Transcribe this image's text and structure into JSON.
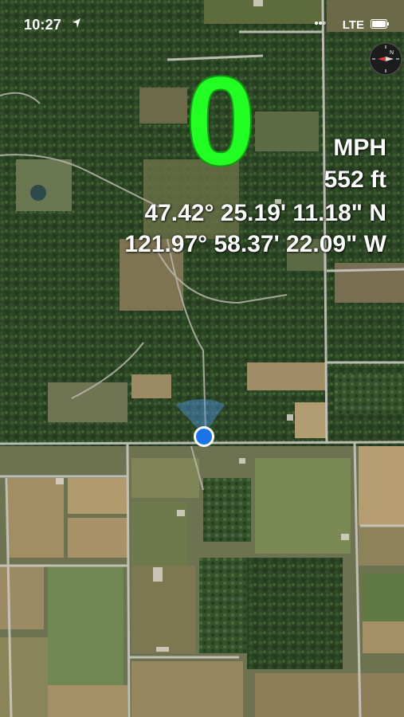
{
  "status_bar": {
    "time": "10:27",
    "carrier": "LTE"
  },
  "speed": {
    "value": "0",
    "units": "MPH",
    "color": "#22ff22"
  },
  "altitude": "552 ft",
  "coordinates": {
    "latitude": "47.42° 25.19' 11.18\" N",
    "longitude": "121.97° 58.37' 22.09\" W"
  },
  "icons": {
    "compass": "compass-icon",
    "location": "user-location-icon",
    "location_arrow": "location-arrow-icon"
  },
  "colors": {
    "map_forest": "#2d4a26",
    "map_field": "#8a7a52",
    "road": "#c8c8c8",
    "location_dot": "#1a73e8"
  }
}
